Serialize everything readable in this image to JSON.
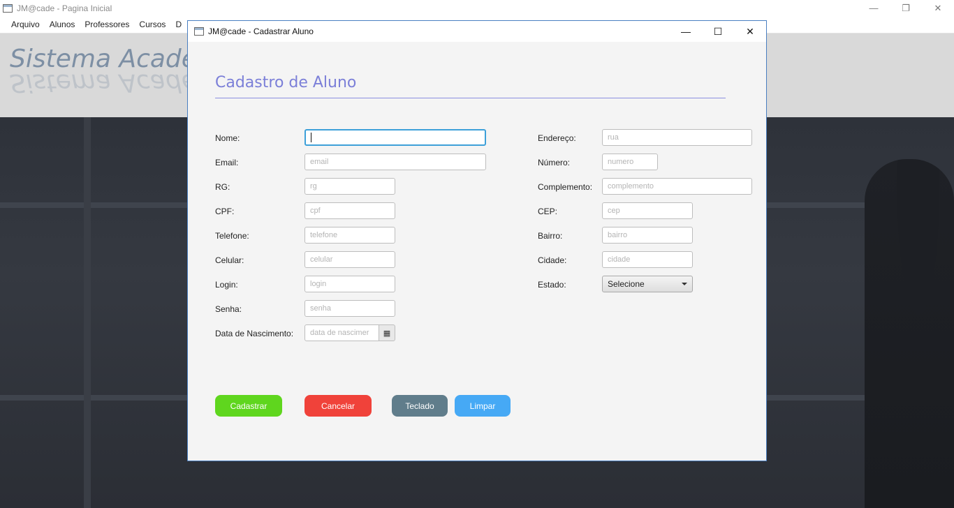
{
  "main_window": {
    "title": "JM@cade - Pagina Inicial",
    "menu": [
      "Arquivo",
      "Alunos",
      "Professores",
      "Cursos",
      "D"
    ],
    "banner_title": "Sistema Acadêmi",
    "controls": {
      "minimize": "—",
      "restore": "❐",
      "close": "✕"
    }
  },
  "dialog": {
    "title": "JM@cade - Cadastrar Aluno",
    "controls": {
      "minimize": "—",
      "maximize": "☐",
      "close": "✕"
    },
    "heading": "Cadastro de Aluno",
    "left_labels": {
      "nome": "Nome:",
      "email": "Email:",
      "rg": "RG:",
      "cpf": "CPF:",
      "telefone": "Telefone:",
      "celular": "Celular:",
      "login": "Login:",
      "senha": "Senha:",
      "nascimento": "Data de Nascimento:"
    },
    "left_placeholders": {
      "nome": "",
      "email": "email",
      "rg": "rg",
      "cpf": "cpf",
      "telefone": "telefone",
      "celular": "celular",
      "login": "login",
      "senha": "senha",
      "nascimento": "data de nascimer"
    },
    "right_labels": {
      "endereco": "Endereço:",
      "numero": "Número:",
      "complemento": "Complemento:",
      "cep": "CEP:",
      "bairro": "Bairro:",
      "cidade": "Cidade:",
      "estado": "Estado:"
    },
    "right_placeholders": {
      "endereco": "rua",
      "numero": "numero",
      "complemento": "complemento",
      "cep": "cep",
      "bairro": "bairro",
      "cidade": "cidade"
    },
    "estado_selected": "Selecione",
    "calendar_icon": "▦",
    "buttons": {
      "cadastrar": "Cadastrar",
      "cancelar": "Cancelar",
      "teclado": "Teclado",
      "limpar": "Limpar"
    },
    "colors": {
      "heading": "#7b7fd8",
      "cadastrar": "#5fd61e",
      "cancelar": "#f0423a",
      "teclado": "#607d8b",
      "limpar": "#46a9f5",
      "focus": "#3da0d9"
    }
  }
}
